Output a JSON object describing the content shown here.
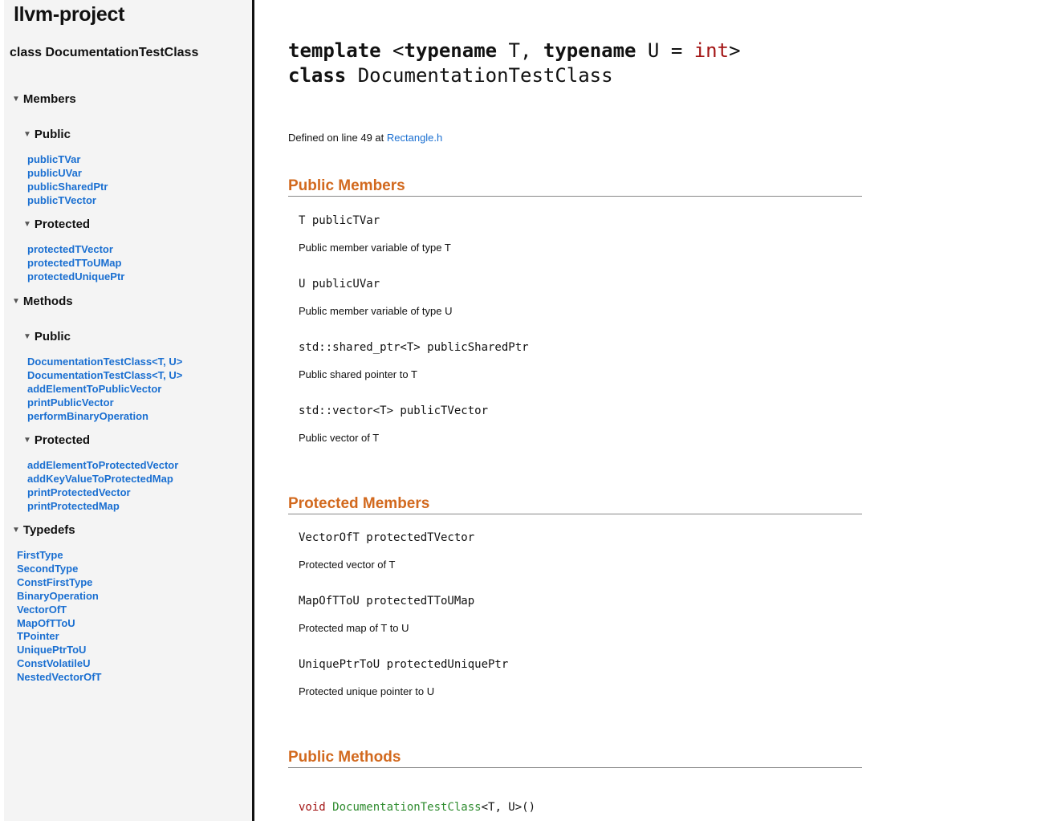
{
  "sidebar": {
    "project_title": "llvm-project",
    "class_title": "class DocumentationTestClass",
    "members": {
      "label": "Members",
      "public": {
        "label": "Public",
        "items": [
          "publicTVar",
          "publicUVar",
          "publicSharedPtr",
          "publicTVector"
        ]
      },
      "protected": {
        "label": "Protected",
        "items": [
          "protectedTVector",
          "protectedTToUMap",
          "protectedUniquePtr"
        ]
      }
    },
    "methods": {
      "label": "Methods",
      "public": {
        "label": "Public",
        "items": [
          "DocumentationTestClass<T, U>",
          "DocumentationTestClass<T, U>",
          "addElementToPublicVector",
          "printPublicVector",
          "performBinaryOperation"
        ]
      },
      "protected": {
        "label": "Protected",
        "items": [
          "addElementToProtectedVector",
          "addKeyValueToProtectedMap",
          "printProtectedVector",
          "printProtectedMap"
        ]
      }
    },
    "typedefs": {
      "label": "Typedefs",
      "items": [
        "FirstType",
        "SecondType",
        "ConstFirstType",
        "BinaryOperation",
        "VectorOfT",
        "MapOfTToU",
        "TPointer",
        "UniquePtrToU",
        "ConstVolatileU",
        "NestedVectorOfT"
      ]
    }
  },
  "main": {
    "decl": {
      "template_kw": "template",
      "open": " <",
      "typename1_kw": "typename",
      "t": " T, ",
      "typename2_kw": "typename",
      "u_eq": " U = ",
      "int_type": "int",
      "close": ">",
      "class_kw": "class",
      "class_name": " DocumentationTestClass"
    },
    "defined": {
      "prefix": "Defined on line 49 at ",
      "file": "Rectangle.h"
    },
    "public_members": {
      "heading": "Public Members",
      "items": [
        {
          "sig": "T publicTVar",
          "desc": "Public member variable of type T"
        },
        {
          "sig": "U publicUVar",
          "desc": "Public member variable of type U"
        },
        {
          "sig": "std::shared_ptr<T> publicSharedPtr",
          "desc": "Public shared pointer to T"
        },
        {
          "sig": "std::vector<T> publicTVector",
          "desc": "Public vector of T"
        }
      ]
    },
    "protected_members": {
      "heading": "Protected Members",
      "items": [
        {
          "sig": "VectorOfT protectedTVector",
          "desc": "Protected vector of T"
        },
        {
          "sig": "MapOfTToU protectedTToUMap",
          "desc": "Protected map of T to U"
        },
        {
          "sig": "UniquePtrToU protectedUniquePtr",
          "desc": "Protected unique pointer to U"
        }
      ]
    },
    "public_methods": {
      "heading": "Public Methods",
      "first": {
        "ret": "void ",
        "name": "DocumentationTestClass",
        "rest": "<T, U>()"
      }
    }
  },
  "colors": {
    "link": "#1a6fd1",
    "heading": "#d2691e",
    "keyword_type": "#a31515",
    "method_name": "#2e8b2e",
    "sidebar_bg": "#f4f4f4"
  },
  "icons": {
    "section_toggle": "triangle-down-icon"
  }
}
